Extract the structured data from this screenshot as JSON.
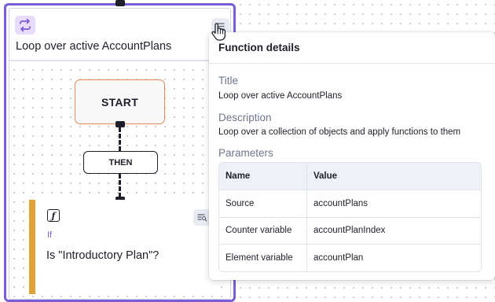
{
  "loop_block": {
    "title": "Loop over active AccountPlans",
    "icon": "loop-arrows-icon",
    "menu_icon": "menu-icon",
    "accent_color": "#7b5cd6"
  },
  "canvas": {
    "start_label": "START",
    "then_label": "THEN"
  },
  "if_card": {
    "icon": "function-icon",
    "kind": "If",
    "label": "Is \"Introductory Plan\"?",
    "menu_icon": "list-search-icon",
    "accent_color": "#e2a23a"
  },
  "function_details": {
    "header": "Function details",
    "title_label": "Title",
    "title_value": "Loop over active AccountPlans",
    "description_label": "Description",
    "description_value": "Loop over a collection of objects and apply functions to them",
    "parameters_label": "Parameters",
    "columns": [
      "Name",
      "Value"
    ],
    "rows": [
      {
        "name": "Source",
        "value": "accountPlans"
      },
      {
        "name": "Counter variable",
        "value": "accountPlanIndex"
      },
      {
        "name": "Element variable",
        "value": "accountPlan"
      }
    ]
  }
}
